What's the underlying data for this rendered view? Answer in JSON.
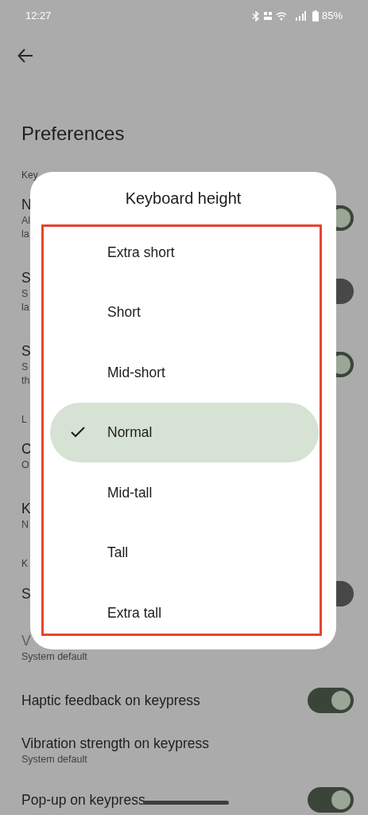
{
  "status_bar": {
    "time": "12:27",
    "battery": "85%"
  },
  "app_bar": {
    "title": "Preferences"
  },
  "settings": [
    {
      "kind": "header",
      "title": "Key"
    },
    {
      "kind": "item",
      "title": "N",
      "subtitle": [
        "Al",
        "la"
      ],
      "switch": {
        "on": true
      }
    },
    {
      "kind": "item",
      "title": "S",
      "subtitle": [
        "S",
        "la"
      ],
      "switch": {
        "on": false
      }
    },
    {
      "kind": "item",
      "title": "S",
      "subtitle": [
        "S",
        "th"
      ],
      "switch": {
        "on": true
      }
    },
    {
      "kind": "header",
      "title": "L"
    },
    {
      "kind": "item",
      "title": "C",
      "subtitle": [
        "O"
      ]
    },
    {
      "kind": "item",
      "title": "K",
      "subtitle": [
        "N"
      ]
    },
    {
      "kind": "header",
      "title": "K"
    },
    {
      "kind": "item",
      "title": "S",
      "switch": {
        "on": false
      }
    },
    {
      "kind": "item",
      "title": "V",
      "subtitle": [
        "System default"
      ],
      "disabled": true
    },
    {
      "kind": "item",
      "title": "Haptic feedback on keypress",
      "switch": {
        "on": true
      }
    },
    {
      "kind": "item",
      "title": "Vibration strength on keypress",
      "subtitle": [
        "System default"
      ]
    },
    {
      "kind": "item",
      "title": "Pop-up on keypress",
      "switch": {
        "on": true
      }
    }
  ],
  "dialog": {
    "title": "Keyboard height",
    "options": [
      {
        "label": "Extra short",
        "selected": false
      },
      {
        "label": "Short",
        "selected": false
      },
      {
        "label": "Mid-short",
        "selected": false
      },
      {
        "label": "Normal",
        "selected": true
      },
      {
        "label": "Mid-tall",
        "selected": false
      },
      {
        "label": "Tall",
        "selected": false
      },
      {
        "label": "Extra tall",
        "selected": false
      }
    ]
  }
}
